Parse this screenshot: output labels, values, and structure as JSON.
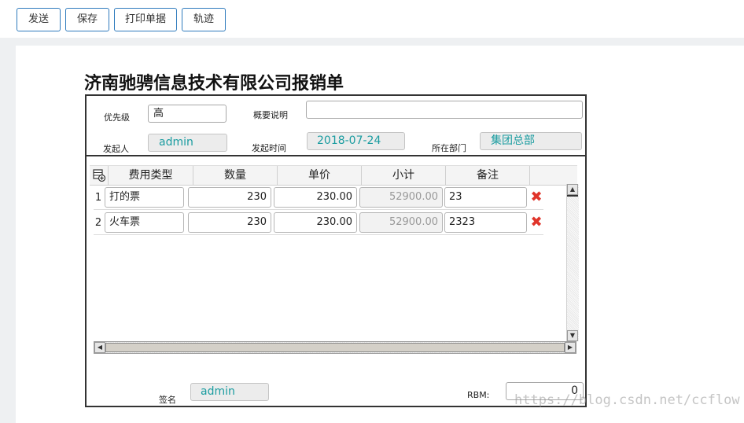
{
  "toolbar": {
    "buttons": [
      {
        "label": "发送"
      },
      {
        "label": "保存"
      },
      {
        "label": "打印单据"
      },
      {
        "label": "轨迹"
      }
    ]
  },
  "form": {
    "title": "济南驰骋信息技术有限公司报销单",
    "priority_label": "优先级",
    "priority_value": "高",
    "summary_label": "概要说明",
    "summary_value": "",
    "initiator_label": "发起人",
    "initiator_value": "admin",
    "time_label": "发起时间",
    "time_value": "2018-07-24",
    "dept_label": "所在部门",
    "dept_value": "集团总部",
    "sign_label": "签名",
    "sign_value": "admin",
    "rbm_label": "RBM:",
    "rbm_value": "0"
  },
  "grid": {
    "add_icon": "add-row-icon",
    "columns": [
      "费用类型",
      "数量",
      "单价",
      "小计",
      "备注"
    ],
    "rows": [
      {
        "num": "1",
        "type": "打的票",
        "qty": "230",
        "price": "230.00",
        "subtotal": "52900.00",
        "note": "23"
      },
      {
        "num": "2",
        "type": "火车票",
        "qty": "230",
        "price": "230.00",
        "subtotal": "52900.00",
        "note": "2323"
      }
    ],
    "delete_glyph": "✖"
  },
  "watermark": "https://blog.csdn.net/ccflow",
  "colors": {
    "accent": "#2f7bbd",
    "readonly_text": "#1a9ca0",
    "delete": "#e0342a"
  }
}
